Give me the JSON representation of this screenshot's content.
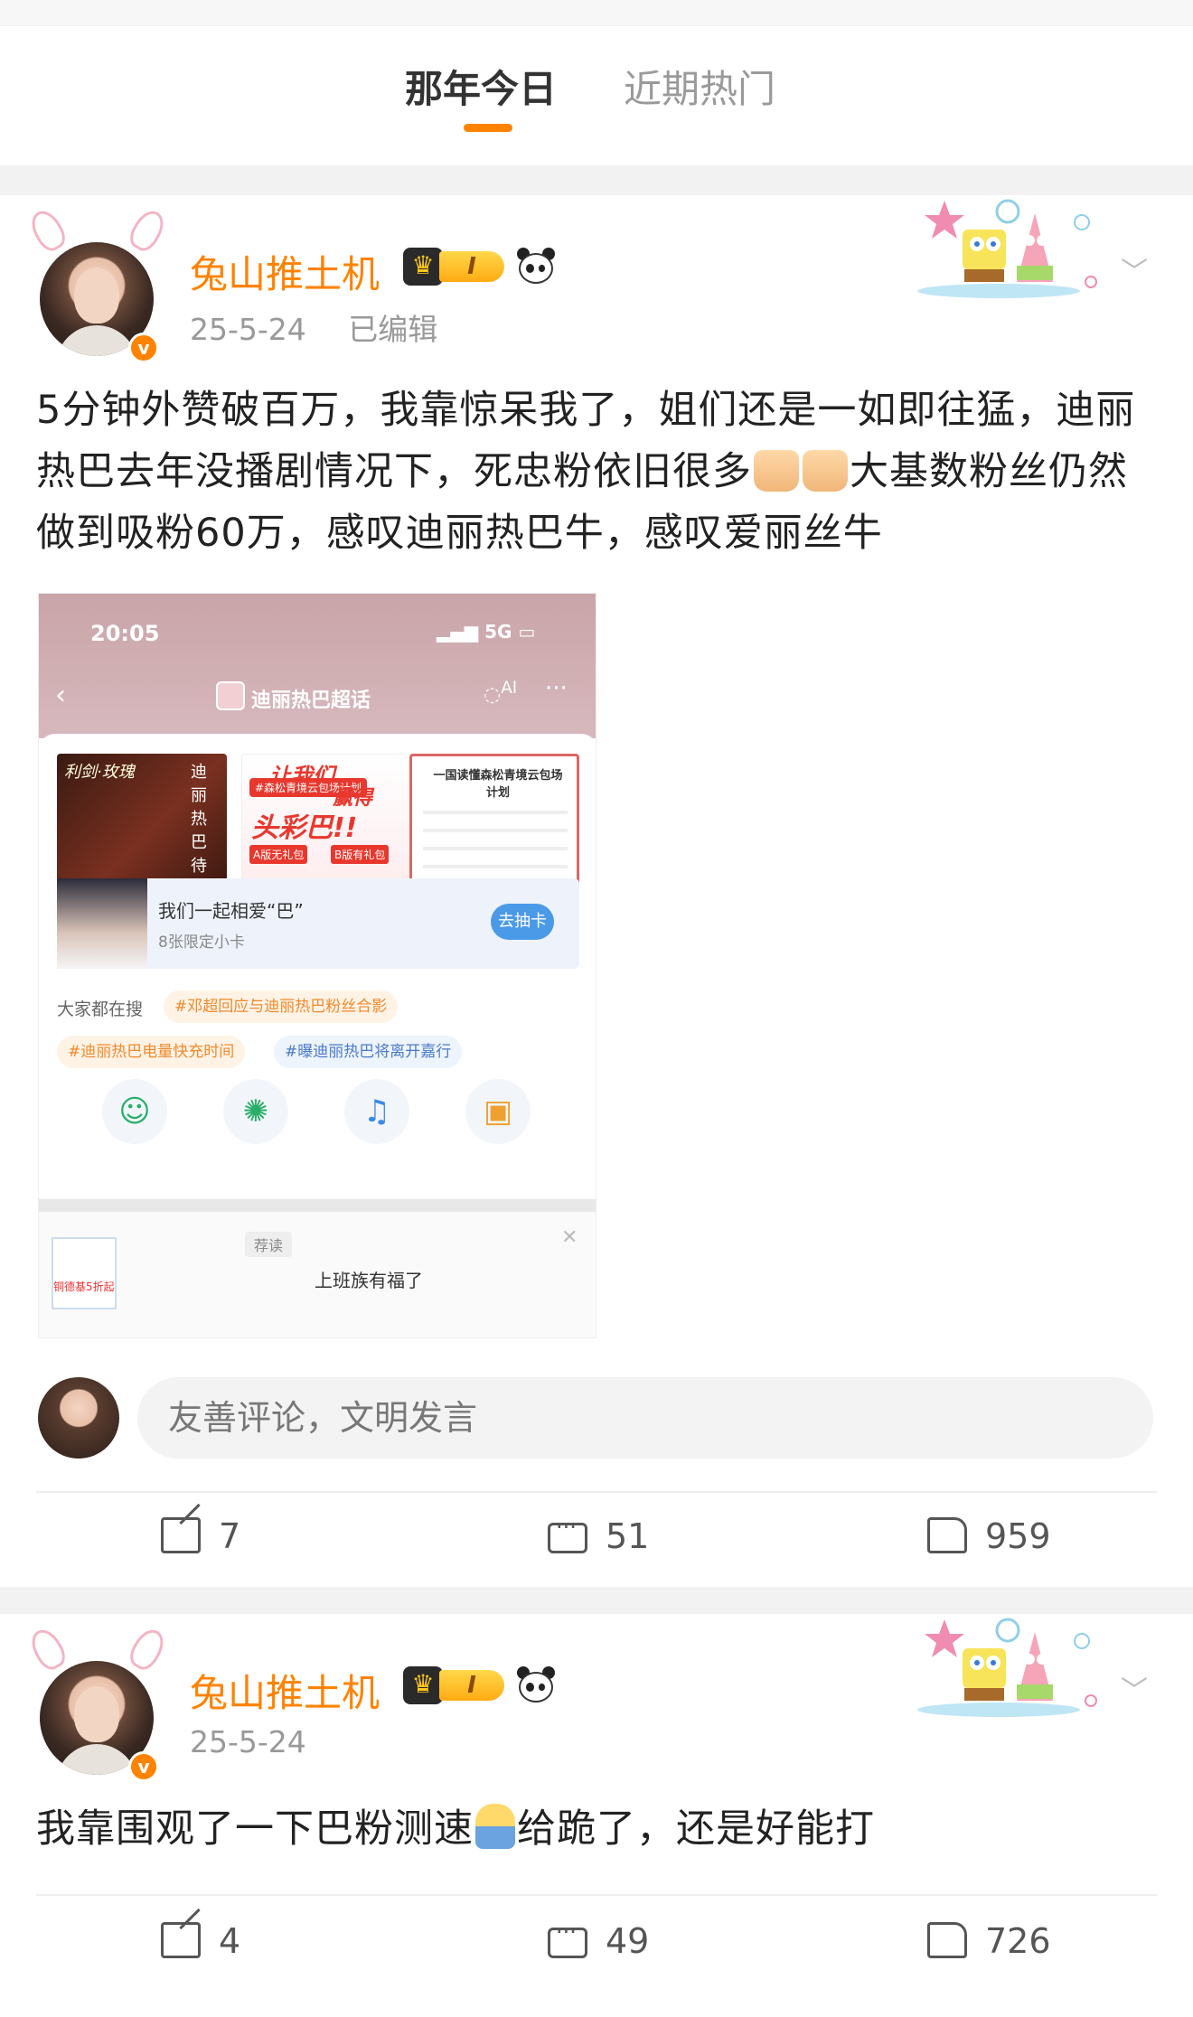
{
  "tabs": [
    {
      "label": "那年今日",
      "active": true
    },
    {
      "label": "近期热门",
      "active": false
    }
  ],
  "accent_color": "#ff8200",
  "posts": [
    {
      "username": "兔山推土机",
      "level": "I",
      "verified_badge": "v",
      "date": "25-5-24",
      "edited": "已编辑",
      "content_parts": [
        "5分钟外赞破百万，我靠惊呆我了，姐们还是一如即往猛，迪丽热巴去年没播剧情况下，死忠粉依旧很多",
        "大基数粉丝仍然做到吸粉60万，感叹迪丽热巴牛，感叹爱丽丝牛"
      ],
      "embedded_screenshot": {
        "time": "20:05",
        "network": "5G",
        "page_title": "迪丽热巴超话",
        "ai_label": "AI",
        "poster1_title": "利剑·玫瑰",
        "poster1_side": "迪丽热巴待播作品",
        "poster2_head1": "让我们",
        "poster2_head2": "赢得",
        "poster2_head3": "头彩巴!!",
        "poster2_tag": "#森松青境云包场计划",
        "poster2_gift_a": "A版无礼包",
        "poster2_gift_b": "B版有礼包",
        "poster3_head": "一国读懂森松青境云包场计划",
        "card_title": "我们一起相爱“巴”",
        "card_sub": "8张限定小卡",
        "card_button": "去抽卡",
        "search_label": "大家都在搜",
        "chips": [
          "#邓超回应与迪丽热巴粉丝合影",
          "#迪丽热巴电量快充时间",
          "#曝迪丽热巴将离开嘉行"
        ],
        "ad_tag": "荐读",
        "ad_text": "上班族有福了",
        "ad_img_text": "铜德基5折起"
      },
      "comment_placeholder": "友善评论，文明发言",
      "reposts": "7",
      "comments": "51",
      "likes": "959"
    },
    {
      "username": "兔山推土机",
      "level": "I",
      "verified_badge": "v",
      "date": "25-5-24",
      "content_parts": [
        "我靠围观了一下巴粉测速",
        "给跪了，还是好能打"
      ],
      "reposts": "4",
      "comments": "49",
      "likes": "726"
    }
  ]
}
